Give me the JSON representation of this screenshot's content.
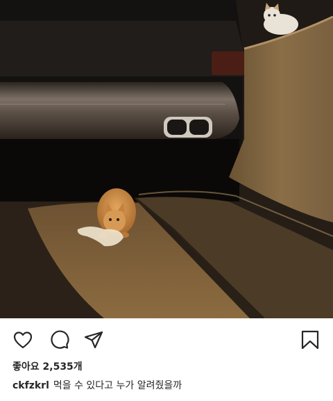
{
  "post": {
    "username": "ckfzkrl",
    "caption": "먹을 수 있다고 누가 알려줬을까",
    "likes_text": "좋아요 2,535개"
  },
  "actions": {
    "icons": [
      "heart-icon",
      "comment-icon",
      "share-icon",
      "bookmark-icon"
    ]
  },
  "colors": {
    "icon": "#262626",
    "text": "#262626"
  }
}
